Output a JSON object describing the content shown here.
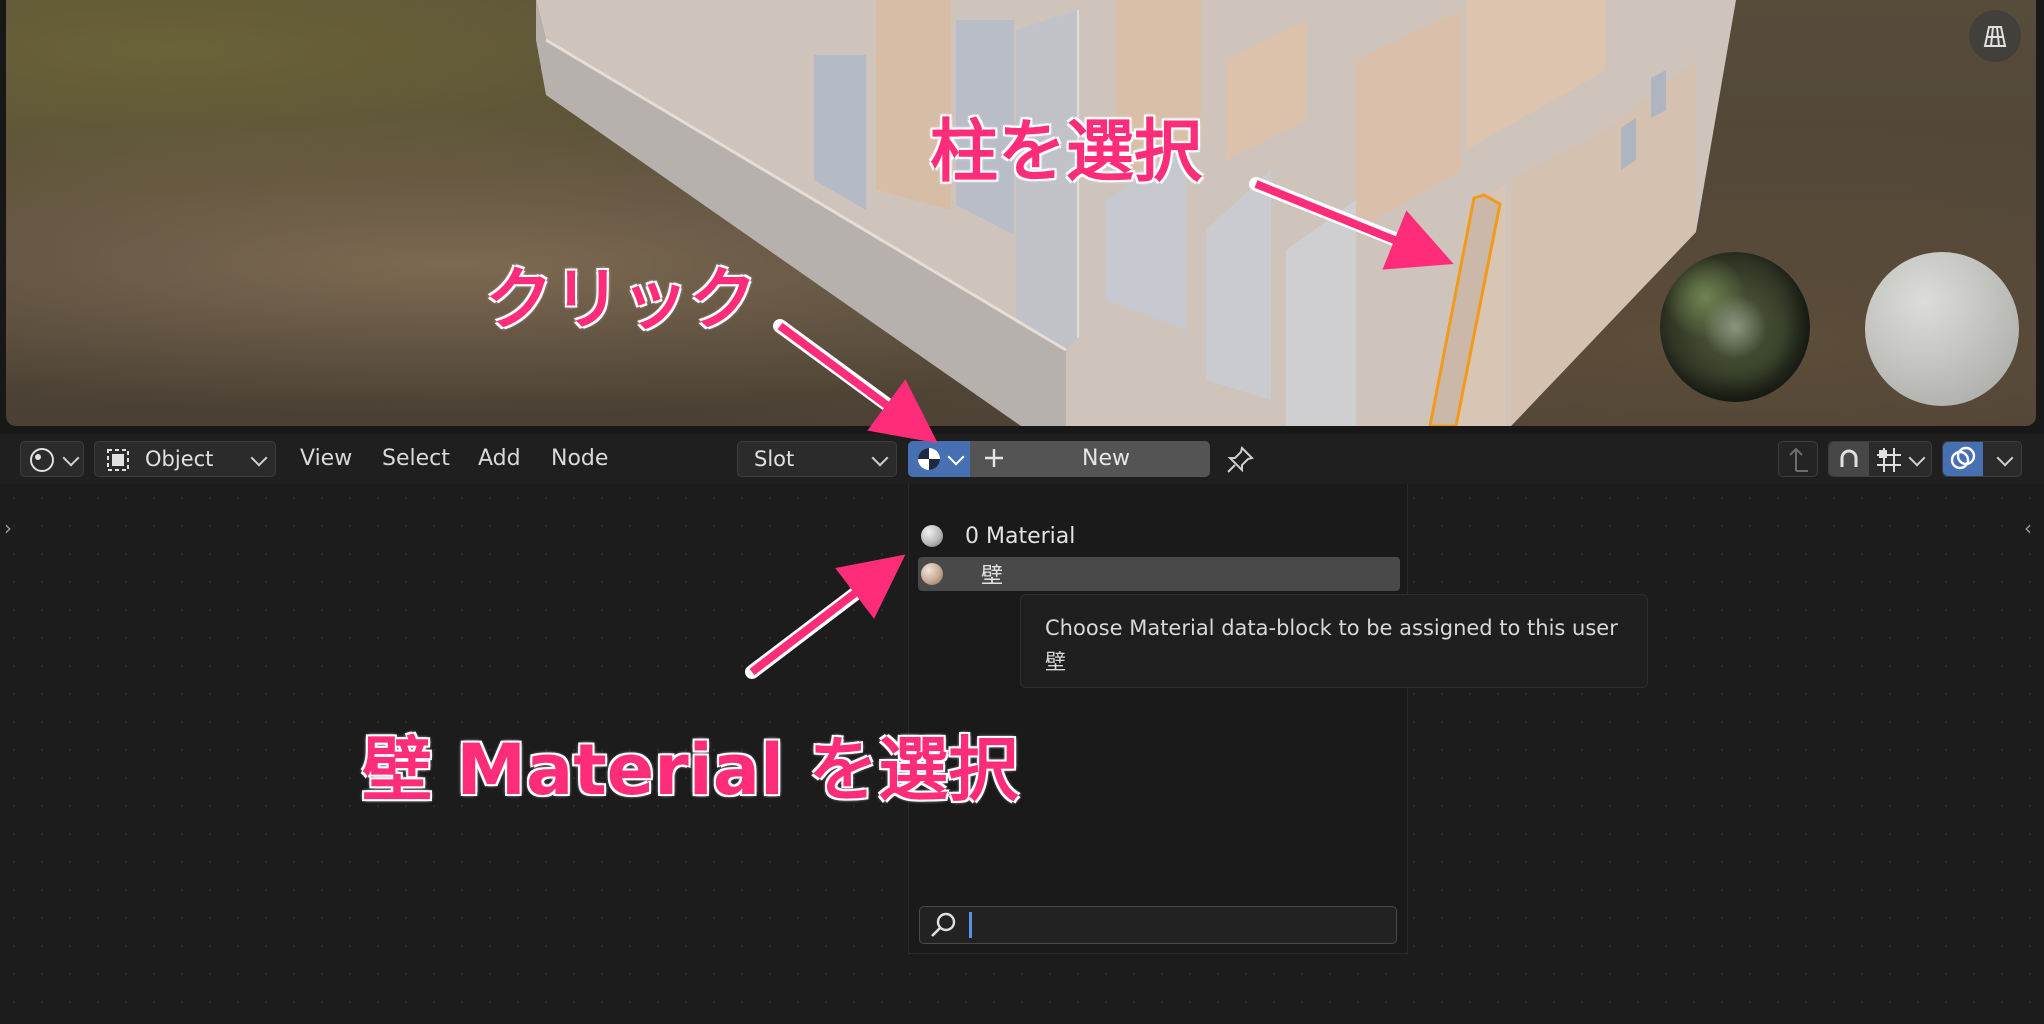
{
  "viewport": {
    "gizmo_icon": "perspective-grid-icon",
    "hdri_preview": "hdri-sphere",
    "matte_preview": "matte-sphere"
  },
  "header": {
    "editor_type_icon": "shader-editor-icon",
    "mode": "Object",
    "menus": [
      "View",
      "Select",
      "Add",
      "Node"
    ],
    "slot": "Slot",
    "new_label": "New",
    "pin_icon": "pin-icon"
  },
  "dropdown": {
    "items": [
      {
        "label": "0 Material",
        "highlighted": false
      },
      {
        "label": "壁",
        "highlighted": true
      }
    ],
    "search_value": ""
  },
  "tooltip": {
    "line1": "Choose Material data-block to be assigned to this user",
    "line2": "壁"
  },
  "annotations": {
    "select_pillar": "柱を選択",
    "click": "クリック",
    "select_wall": "壁 Material を選択"
  },
  "colors": {
    "accent": "#4770b3",
    "annotation": "#ff2d79",
    "selection_outline": "#f29a1a"
  }
}
